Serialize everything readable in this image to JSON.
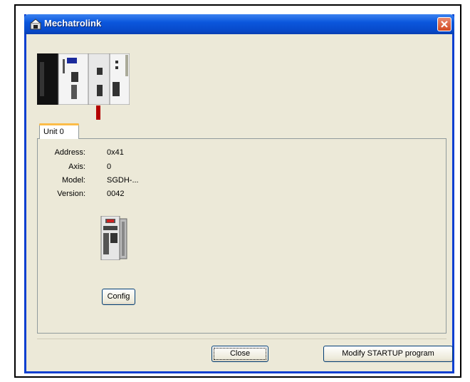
{
  "window": {
    "title": "Mechatrolink"
  },
  "tabs": [
    {
      "label": "Unit 0"
    }
  ],
  "unit": {
    "address_label": "Address:",
    "address_value": "0x41",
    "axis_label": "Axis:",
    "axis_value": "0",
    "model_label": "Model:",
    "model_value": "SGDH-...",
    "version_label": "Version:",
    "version_value": "0042"
  },
  "buttons": {
    "config": "Config",
    "close": "Close",
    "modify_startup": "Modify STARTUP program"
  },
  "icons": {
    "title": "mechatrolink-app-icon",
    "close": "close-icon",
    "rack": "controller-rack-image",
    "servo": "servo-drive-image",
    "marker": "selected-unit-marker"
  },
  "colors": {
    "titlebar": "#0b57dd",
    "window_bg": "#ece9d8",
    "close_button": "#d24a22",
    "marker": "#b40000"
  }
}
